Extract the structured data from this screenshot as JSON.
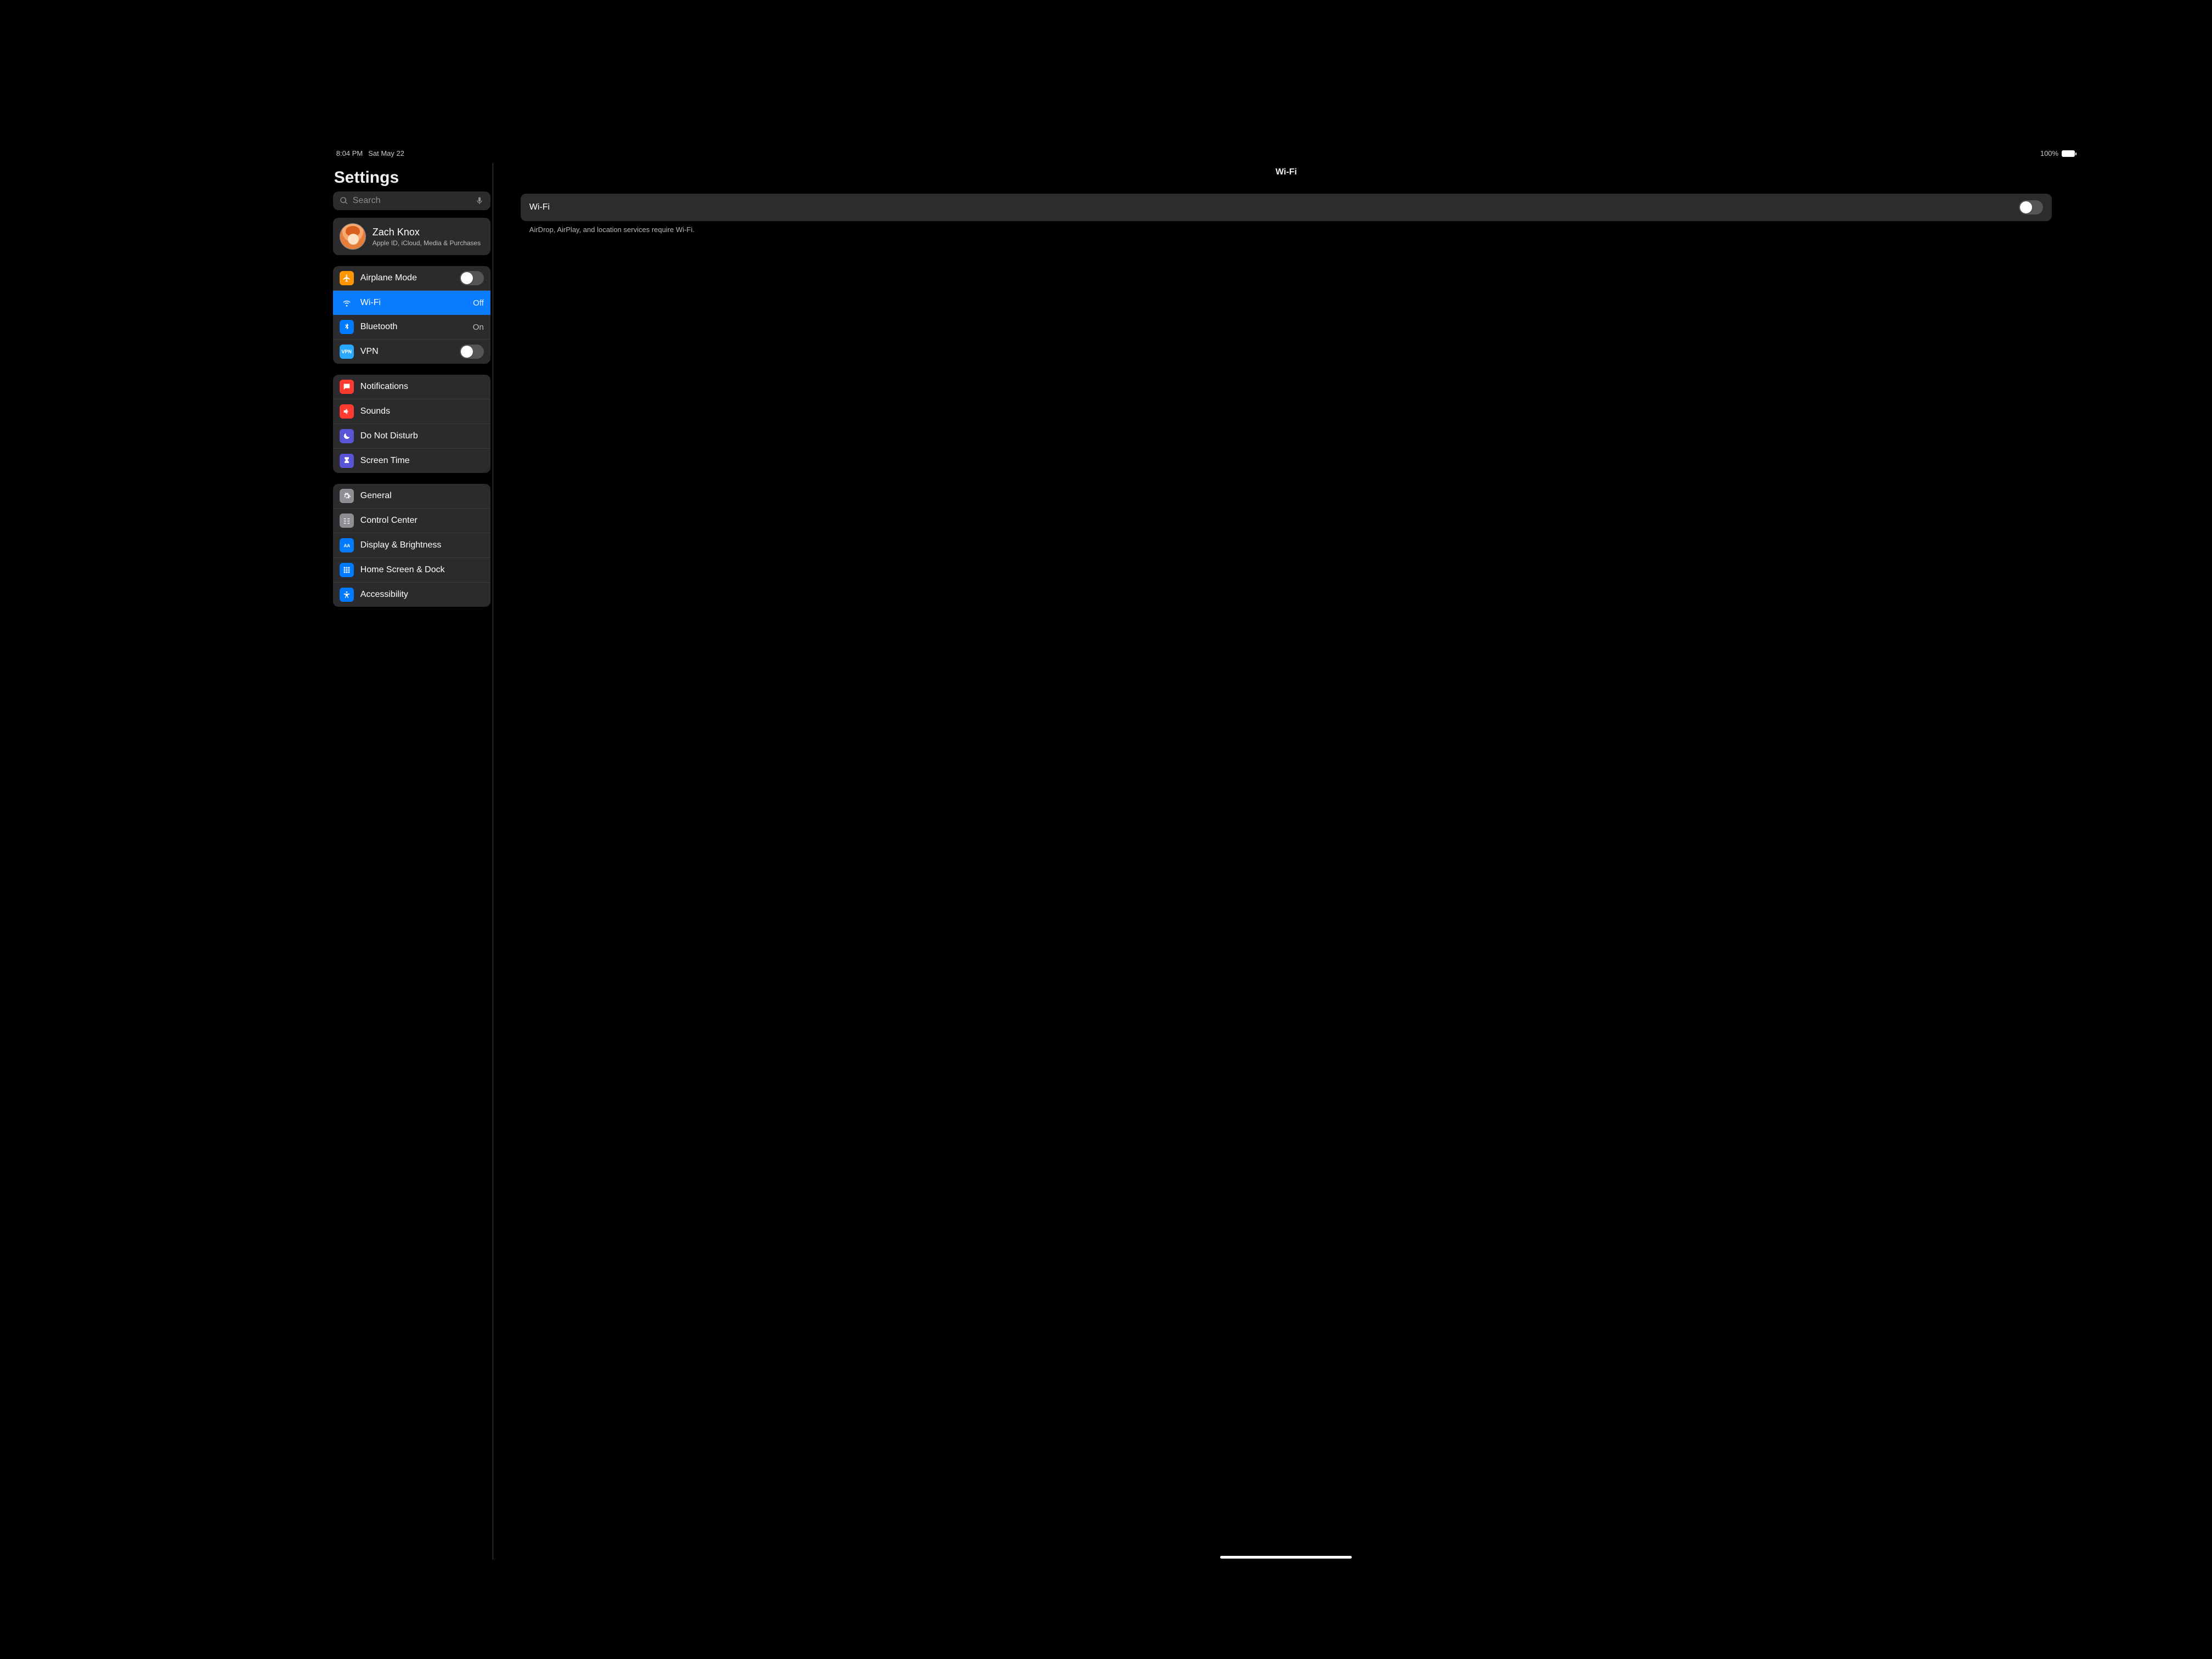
{
  "status": {
    "time": "8:04 PM",
    "date": "Sat May 22",
    "battery_pct": "100%"
  },
  "sidebar": {
    "title": "Settings",
    "search_placeholder": "Search",
    "account": {
      "name": "Zach Knox",
      "sub": "Apple ID, iCloud, Media & Purchases"
    },
    "group1": {
      "airplane": {
        "label": "Airplane Mode",
        "on": false
      },
      "wifi": {
        "label": "Wi-Fi",
        "value": "Off"
      },
      "bluetooth": {
        "label": "Bluetooth",
        "value": "On"
      },
      "vpn": {
        "label": "VPN",
        "on": false
      }
    },
    "group2": {
      "notifications": {
        "label": "Notifications"
      },
      "sounds": {
        "label": "Sounds"
      },
      "dnd": {
        "label": "Do Not Disturb"
      },
      "screentime": {
        "label": "Screen Time"
      }
    },
    "group3": {
      "general": {
        "label": "General"
      },
      "control": {
        "label": "Control Center"
      },
      "display": {
        "label": "Display & Brightness"
      },
      "homescreen": {
        "label": "Home Screen & Dock"
      },
      "accessibility": {
        "label": "Accessibility"
      }
    }
  },
  "detail": {
    "title": "Wi-Fi",
    "row_label": "Wi-Fi",
    "wifi_on": false,
    "footer": "AirDrop, AirPlay, and location services require Wi-Fi."
  }
}
